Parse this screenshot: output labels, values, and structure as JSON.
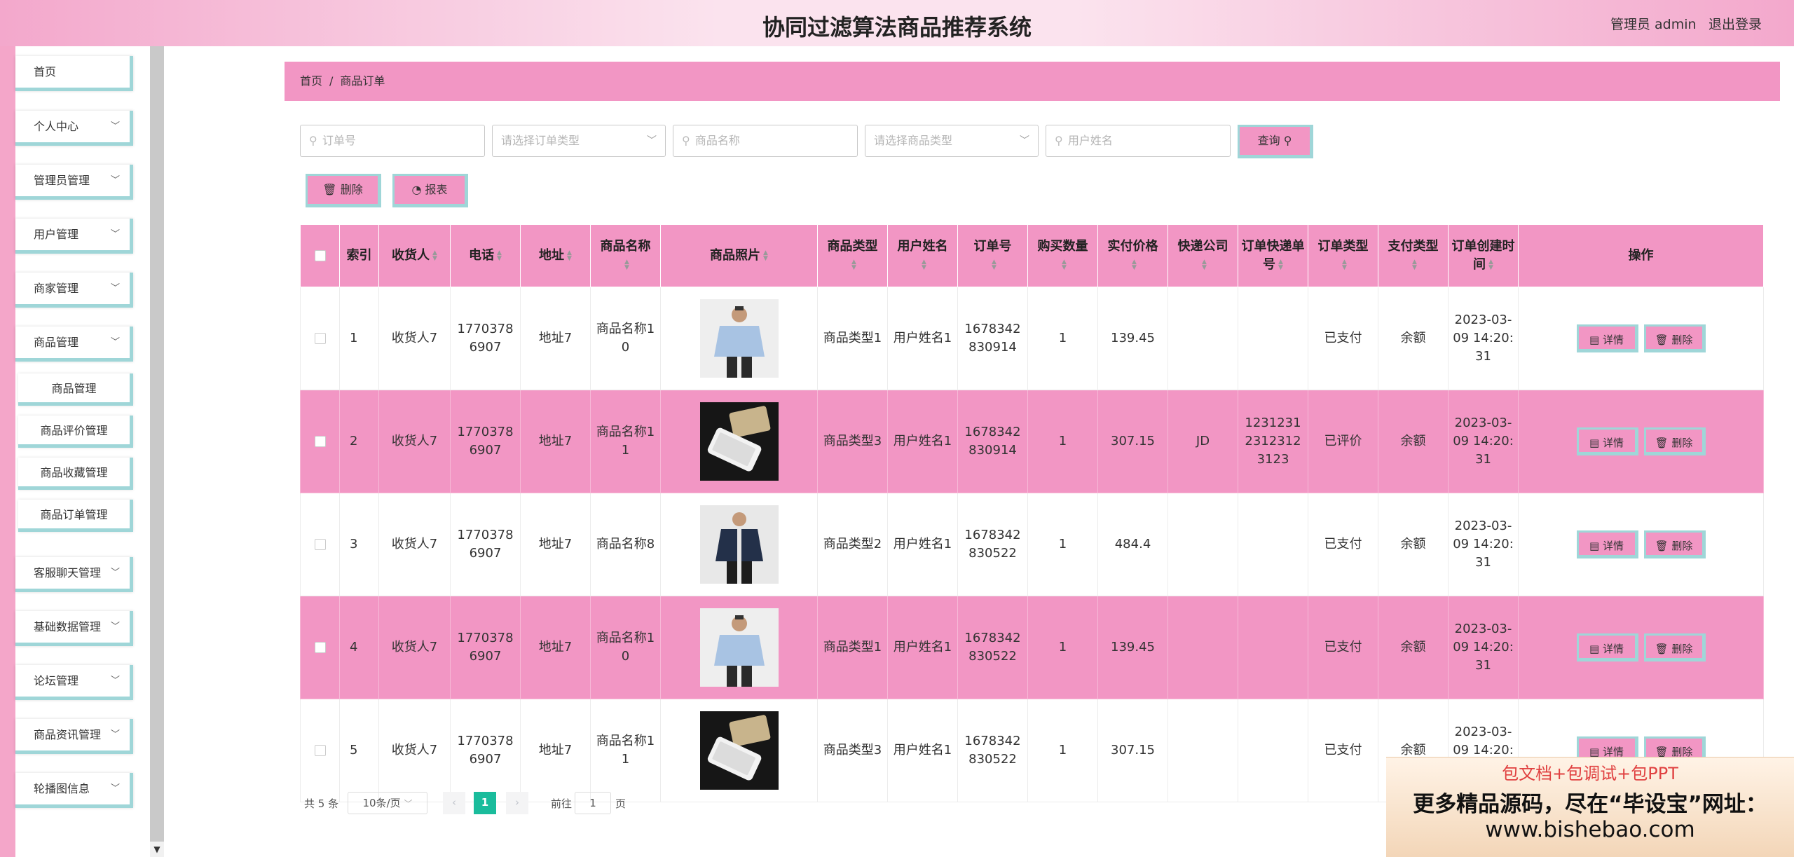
{
  "header": {
    "title": "协同过滤算法商品推荐系统",
    "admin": "管理员 admin",
    "logout": "退出登录"
  },
  "sidebar": {
    "items": [
      {
        "label": "首页"
      },
      {
        "label": "个人中心"
      },
      {
        "label": "管理员管理"
      },
      {
        "label": "用户管理"
      },
      {
        "label": "商家管理"
      },
      {
        "label": "商品管理"
      },
      {
        "label": "客服聊天管理"
      },
      {
        "label": "基础数据管理"
      },
      {
        "label": "论坛管理"
      },
      {
        "label": "商品资讯管理"
      },
      {
        "label": "轮播图信息"
      }
    ],
    "sub": [
      {
        "label": "商品管理"
      },
      {
        "label": "商品评价管理"
      },
      {
        "label": "商品收藏管理"
      },
      {
        "label": "商品订单管理"
      }
    ]
  },
  "breadcrumb": {
    "home": "首页",
    "sep": "/",
    "current": "商品订单"
  },
  "search": {
    "order_no": "订单号",
    "order_type": "请选择订单类型",
    "goods_name": "商品名称",
    "goods_type": "请选择商品类型",
    "user_name": "用户姓名",
    "query": "查询"
  },
  "actions": {
    "delete": "删除",
    "report": "报表"
  },
  "table": {
    "headers": [
      "索引",
      "收货人",
      "电话",
      "地址",
      "商品名称",
      "商品照片",
      "商品类型",
      "用户姓名",
      "订单号",
      "购买数量",
      "实付价格",
      "快递公司",
      "订单快递单号",
      "订单类型",
      "支付类型",
      "订单创建时间",
      "操作"
    ],
    "detail_label": "详情",
    "delete_label": "删除",
    "rows": [
      {
        "idx": "1",
        "receiver": "收货人7",
        "phone": "17703786907",
        "addr": "地址7",
        "name": "商品名称10",
        "photo": "shirt-man",
        "type": "商品类型1",
        "user": "用户姓名1",
        "order": "1678342830914",
        "qty": "1",
        "price": "139.45",
        "express": "",
        "express_no": "",
        "order_type": "已支付",
        "pay": "余额",
        "time": "2023-03-09 14:20:31"
      },
      {
        "idx": "2",
        "receiver": "收货人7",
        "phone": "17703786907",
        "addr": "地址7",
        "name": "商品名称11",
        "photo": "phone",
        "type": "商品类型3",
        "user": "用户姓名1",
        "order": "1678342830914",
        "qty": "1",
        "price": "307.15",
        "express": "JD",
        "express_no": "123123123123123123",
        "order_type": "已评价",
        "pay": "余额",
        "time": "2023-03-09 14:20:31"
      },
      {
        "idx": "3",
        "receiver": "收货人7",
        "phone": "17703786907",
        "addr": "地址7",
        "name": "商品名称8",
        "photo": "jacket-man",
        "type": "商品类型2",
        "user": "用户姓名1",
        "order": "1678342830522",
        "qty": "1",
        "price": "484.4",
        "express": "",
        "express_no": "",
        "order_type": "已支付",
        "pay": "余额",
        "time": "2023-03-09 14:20:31"
      },
      {
        "idx": "4",
        "receiver": "收货人7",
        "phone": "17703786907",
        "addr": "地址7",
        "name": "商品名称10",
        "photo": "shirt-man",
        "type": "商品类型1",
        "user": "用户姓名1",
        "order": "1678342830522",
        "qty": "1",
        "price": "139.45",
        "express": "",
        "express_no": "",
        "order_type": "已支付",
        "pay": "余额",
        "time": "2023-03-09 14:20:31"
      },
      {
        "idx": "5",
        "receiver": "收货人7",
        "phone": "17703786907",
        "addr": "地址7",
        "name": "商品名称11",
        "photo": "phone",
        "type": "商品类型3",
        "user": "用户姓名1",
        "order": "1678342830522",
        "qty": "1",
        "price": "307.15",
        "express": "",
        "express_no": "",
        "order_type": "已支付",
        "pay": "余额",
        "time": "2023-03-09 14:20:31"
      }
    ]
  },
  "pagination": {
    "total": "共 5 条",
    "page_size": "10条/页",
    "current": "1",
    "goto_prefix": "前往",
    "goto_value": "1",
    "goto_suffix": "页"
  },
  "watermark": {
    "line1": "包文档+包调试+包PPT",
    "line2": "更多精品源码，尽在“毕设宝”网址：",
    "line3": "www.bishebao.com"
  },
  "colors": {
    "pink": "#f296c4",
    "teal": "#9fd6d8",
    "active_page": "#1abc9c"
  }
}
